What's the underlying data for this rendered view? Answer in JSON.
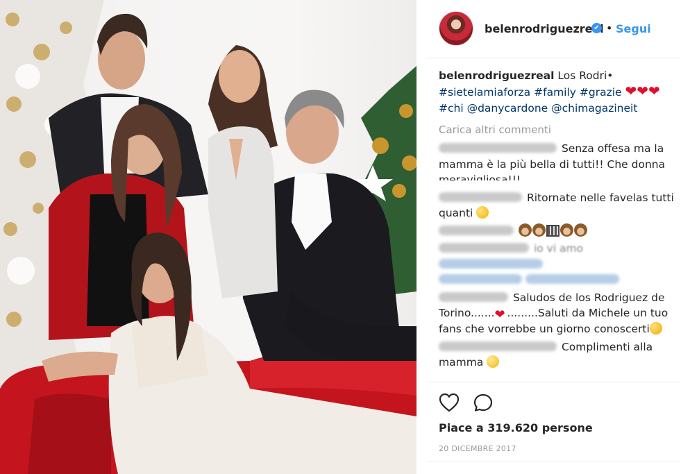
{
  "post": {
    "image_alt": "",
    "header": {
      "username": "belenrodriguezreal",
      "verified_mark": "✔",
      "separator": "•",
      "follow_label": "Segui"
    },
    "caption": {
      "username": "belenrodriguezreal",
      "text": "Los Rodri•",
      "tags_line1": [
        "#sietelamiaforza",
        "#family",
        "#grazie"
      ],
      "tags_line2": [
        "#chi",
        "@danycardone",
        "@chimagazineit"
      ]
    },
    "load_more": "Carica altri commenti",
    "comments": [
      {
        "text_a": "Senza offesa ma la",
        "text_b": "mamma è la più bella di tutti!! Che donna",
        "text_c": "meravigliosa!!!"
      },
      {
        "text_a": "Ritornate nelle favelas tutti",
        "text_b": "quanti"
      },
      {
        "text_a": ""
      },
      {
        "text_a": "io vi amo"
      },
      {
        "text_a": "Saludos de los Rodriguez de",
        "text_b": "Torino.......",
        "text_c": ".........Saluti da Michele un tuo",
        "text_d": "fans  che vorrebbe un giorno conoscerti"
      },
      {
        "text_a": "Complimenti alla",
        "text_b": "mamma"
      }
    ],
    "likes_text": "Piace a 319.620 persone",
    "date": "20 DICEMBRE 2017"
  },
  "icons": {
    "like": "heart-outline-icon",
    "comment": "speech-bubble-icon",
    "verified": "verified-badge-icon"
  },
  "colors": {
    "link": "#003569",
    "follow": "#3897f0",
    "muted": "#999999",
    "text": "#262626",
    "heart": "#e0102c"
  }
}
